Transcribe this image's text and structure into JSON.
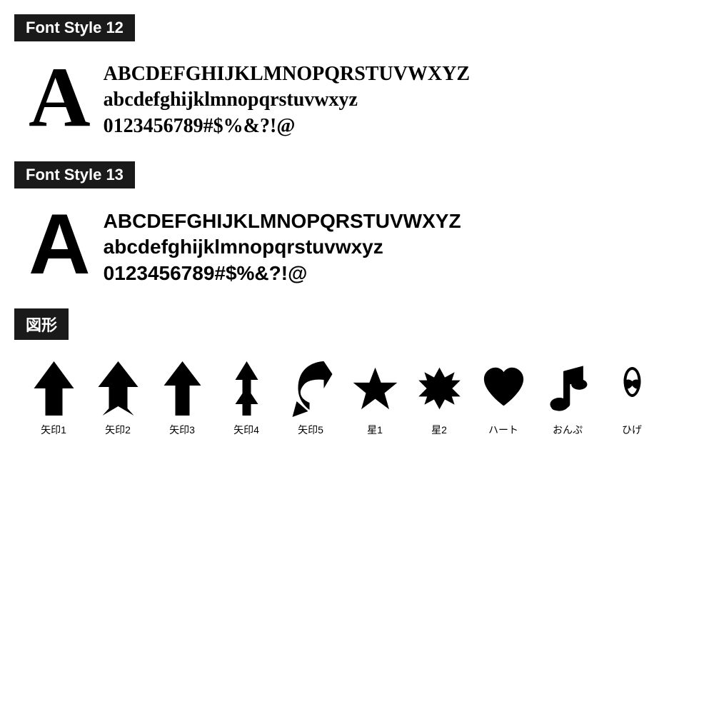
{
  "fontStyle12": {
    "label": "Font Style 12",
    "bigLetter": "A",
    "lines": [
      "ABCDEFGHIJKLMNOPQRSTUVWXYZ",
      "abcdefghijklmnopqrstuvwxyz",
      "0123456789#$%&?!@"
    ]
  },
  "fontStyle13": {
    "label": "Font Style 13",
    "bigLetter": "A",
    "lines": [
      "ABCDEFGHIJKLMNOPQRSTUVWXYZ",
      "abcdefghijklmnopqrstuvwxyz",
      "0123456789#$%&?!@"
    ]
  },
  "shapes": {
    "label": "図形",
    "items": [
      {
        "name": "矢印1",
        "type": "arrow1"
      },
      {
        "name": "矢印2",
        "type": "arrow2"
      },
      {
        "name": "矢印3",
        "type": "arrow3"
      },
      {
        "name": "矢印4",
        "type": "arrow4"
      },
      {
        "name": "矢印5",
        "type": "arrow5"
      },
      {
        "name": "星1",
        "type": "star1"
      },
      {
        "name": "星2",
        "type": "star2"
      },
      {
        "name": "ハート",
        "type": "heart"
      },
      {
        "name": "おんぷ",
        "type": "music"
      },
      {
        "name": "ひげ",
        "type": "mustache"
      }
    ]
  }
}
